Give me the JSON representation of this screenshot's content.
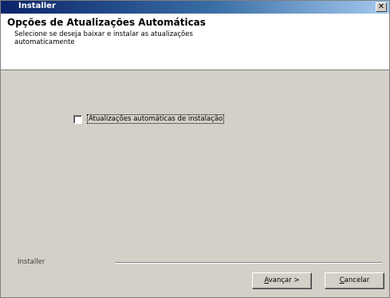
{
  "window": {
    "title": "Installer",
    "close_glyph": "✕"
  },
  "header": {
    "title": "Opções de Atualizações Automáticas",
    "subtitle_line1": "Selecione se deseja baixar e instalar as atualizações",
    "subtitle_line2": "automaticamente"
  },
  "options": {
    "auto_updates_label": "Atualizações automáticas de instalação",
    "auto_updates_checked": false
  },
  "footer": {
    "brand": "Installer",
    "next_mnemonic": "A",
    "next_rest": "vançar >",
    "cancel_mnemonic": "C",
    "cancel_rest": "ancelar"
  }
}
